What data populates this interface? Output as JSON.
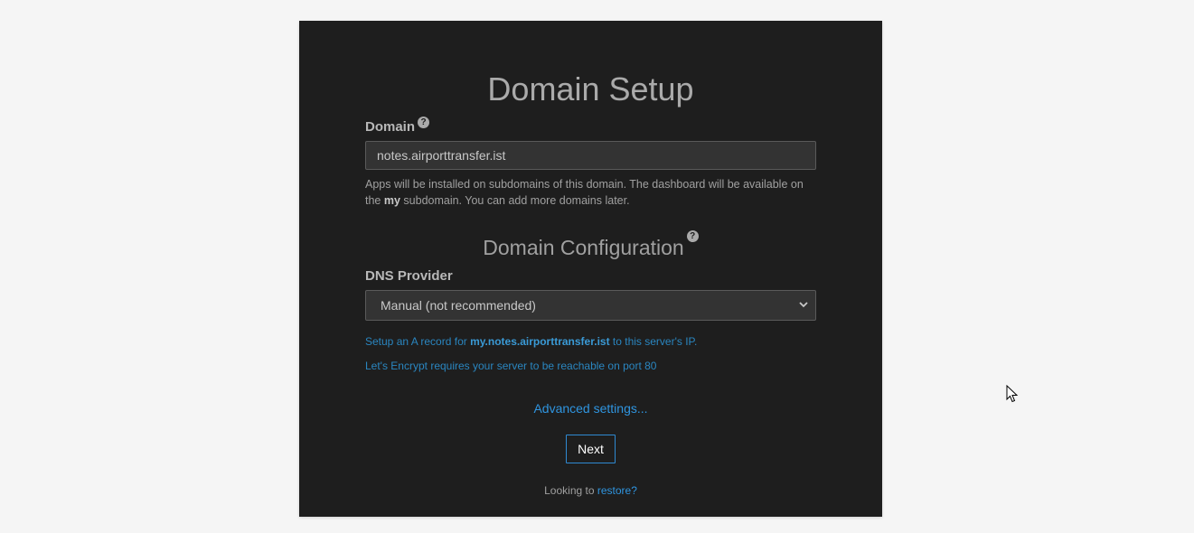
{
  "setup": {
    "title": "Domain Setup",
    "domain_label": "Domain",
    "domain_value": "notes.airporttransfer.ist",
    "domain_help_part1": "Apps will be installed on subdomains of this domain. The dashboard will be available on the ",
    "domain_help_bold": "my",
    "domain_help_part2": " subdomain. You can add more domains later.",
    "config_title": "Domain Configuration",
    "dns_label": "DNS Provider",
    "dns_selected": "Manual (not recommended)",
    "record_prefix": "Setup an A record for ",
    "record_host": "my.notes.airporttransfer.ist",
    "record_suffix": " to this server's IP.",
    "letsencrypt_note": "Let's Encrypt requires your server to be reachable on port 80",
    "advanced_link": "Advanced settings...",
    "next_label": "Next",
    "restore_prefix": "Looking to ",
    "restore_link": "restore?"
  },
  "icons": {
    "help": "question-circle-icon",
    "chevron": "chevron-down-icon",
    "cursor": "mouse-cursor-icon"
  },
  "colors": {
    "card_bg": "#1e1e1e",
    "page_bg": "#f5f5f5",
    "accent": "#2f95e0"
  }
}
